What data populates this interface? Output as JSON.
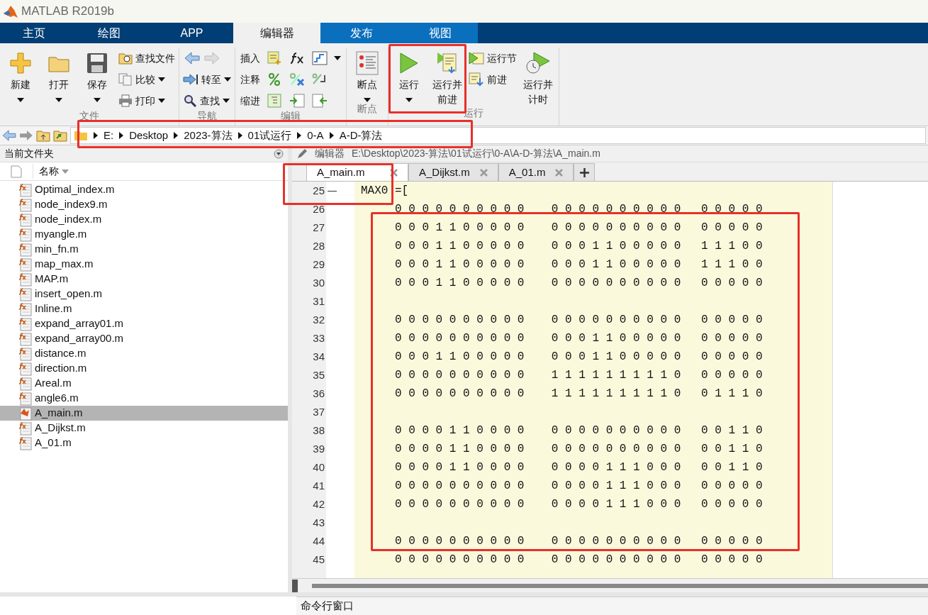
{
  "window": {
    "title": "MATLAB R2019b"
  },
  "tabs": [
    {
      "label": "主页",
      "selected": false,
      "kind": "main"
    },
    {
      "label": "绘图",
      "selected": false,
      "kind": "main"
    },
    {
      "label": "APP",
      "selected": false,
      "kind": "main"
    },
    {
      "label": "编辑器",
      "selected": true
    },
    {
      "label": "发布",
      "selected": false,
      "kind": "contextual"
    },
    {
      "label": "视图",
      "selected": false,
      "kind": "contextual"
    }
  ],
  "ribbon": {
    "groups": [
      {
        "label": "文件",
        "items": [
          {
            "kind": "large",
            "label": "新建",
            "dropdown": true
          },
          {
            "kind": "large",
            "label": "打开",
            "dropdown": true
          },
          {
            "kind": "large",
            "label": "保存",
            "dropdown": true
          },
          {
            "kind": "stack",
            "entries": [
              {
                "label": "查找文件",
                "dropdown": false
              },
              {
                "label": "比较",
                "dropdown": true
              },
              {
                "label": "打印",
                "dropdown": true
              }
            ]
          }
        ]
      },
      {
        "label": "导航",
        "items": [
          {
            "kind": "stack",
            "entries": [
              {
                "kind": "arrows"
              },
              {
                "label": "转至",
                "dropdown": true
              },
              {
                "label": "查找",
                "dropdown": true
              }
            ]
          }
        ]
      },
      {
        "label": "编辑",
        "items": [
          {
            "kind": "rows",
            "entries": [
              {
                "label": "插入",
                "dropdown": true
              },
              {
                "label": "注释",
                "dropdown": false
              },
              {
                "label": "缩进",
                "dropdown": false
              }
            ]
          }
        ]
      },
      {
        "label": "断点",
        "items": [
          {
            "kind": "large",
            "label": "断点",
            "dropdown": true
          }
        ]
      },
      {
        "label": "运行",
        "items": [
          {
            "kind": "large",
            "label": "运行",
            "dropdown": true
          },
          {
            "kind": "large",
            "lines": [
              "运行并",
              "前进"
            ],
            "dropdown": false
          },
          {
            "kind": "stack",
            "entries": [
              {
                "label": "运行节",
                "dropdown": false
              },
              {
                "label": "前进",
                "dropdown": false
              }
            ]
          },
          {
            "kind": "large",
            "lines": [
              "运行并",
              "计时"
            ],
            "dropdown": false
          }
        ]
      }
    ]
  },
  "address_bar": {
    "segments": [
      "E:",
      "Desktop",
      "2023-算法",
      "01试运行",
      "0-A",
      "A-D-算法"
    ]
  },
  "file_browser": {
    "title": "当前文件夹",
    "column": "名称",
    "files": [
      {
        "name": "Optimal_index.m",
        "kind": "function",
        "selected": false
      },
      {
        "name": "node_index9.m",
        "kind": "function",
        "selected": false
      },
      {
        "name": "node_index.m",
        "kind": "function",
        "selected": false
      },
      {
        "name": "myangle.m",
        "kind": "function",
        "selected": false
      },
      {
        "name": "min_fn.m",
        "kind": "function",
        "selected": false
      },
      {
        "name": "map_max.m",
        "kind": "function",
        "selected": false
      },
      {
        "name": "MAP.m",
        "kind": "function",
        "selected": false
      },
      {
        "name": "insert_open.m",
        "kind": "function",
        "selected": false
      },
      {
        "name": "Inline.m",
        "kind": "function",
        "selected": false
      },
      {
        "name": "expand_array01.m",
        "kind": "function",
        "selected": false
      },
      {
        "name": "expand_array00.m",
        "kind": "function",
        "selected": false
      },
      {
        "name": "distance.m",
        "kind": "function",
        "selected": false
      },
      {
        "name": "direction.m",
        "kind": "function",
        "selected": false
      },
      {
        "name": "Areal.m",
        "kind": "function",
        "selected": false
      },
      {
        "name": "angle6.m",
        "kind": "function",
        "selected": false
      },
      {
        "name": "A_main.m",
        "kind": "script",
        "selected": true
      },
      {
        "name": "A_Dijkst.m",
        "kind": "function",
        "selected": false
      },
      {
        "name": "A_01.m",
        "kind": "function",
        "selected": false
      }
    ]
  },
  "editor": {
    "label": "编辑器",
    "path": "E:\\Desktop\\2023-算法\\01试运行\\0-A\\A-D-算法\\A_main.m",
    "tabs": [
      {
        "label": "A_main.m",
        "selected": true
      },
      {
        "label": "A_Dijkst.m",
        "selected": false
      },
      {
        "label": "A_01.m",
        "selected": false
      }
    ],
    "lines": [
      {
        "number": "25",
        "marker": "—",
        "text": "MAX0 =["
      },
      {
        "number": "26",
        "text": "     0 0 0 0 0 0 0 0 0 0    0 0 0 0 0 0 0 0 0 0   0 0 0 0 0"
      },
      {
        "number": "27",
        "text": "     0 0 0 1 1 0 0 0 0 0    0 0 0 0 0 0 0 0 0 0   0 0 0 0 0"
      },
      {
        "number": "28",
        "text": "     0 0 0 1 1 0 0 0 0 0    0 0 0 1 1 0 0 0 0 0   1 1 1 0 0"
      },
      {
        "number": "29",
        "text": "     0 0 0 1 1 0 0 0 0 0    0 0 0 1 1 0 0 0 0 0   1 1 1 0 0"
      },
      {
        "number": "30",
        "text": "     0 0 0 1 1 0 0 0 0 0    0 0 0 0 0 0 0 0 0 0   0 0 0 0 0"
      },
      {
        "number": "31"
      },
      {
        "number": "32",
        "text": "     0 0 0 0 0 0 0 0 0 0    0 0 0 0 0 0 0 0 0 0   0 0 0 0 0"
      },
      {
        "number": "33",
        "text": "     0 0 0 0 0 0 0 0 0 0    0 0 0 1 1 0 0 0 0 0   0 0 0 0 0"
      },
      {
        "number": "34",
        "text": "     0 0 0 1 1 0 0 0 0 0    0 0 0 1 1 0 0 0 0 0   0 0 0 0 0"
      },
      {
        "number": "35",
        "text": "     0 0 0 0 0 0 0 0 0 0    1 1 1 1 1 1 1 1 1 0   0 0 0 0 0"
      },
      {
        "number": "36",
        "text": "     0 0 0 0 0 0 0 0 0 0    1 1 1 1 1 1 1 1 1 0   0 1 1 1 0"
      },
      {
        "number": "37"
      },
      {
        "number": "38",
        "text": "     0 0 0 0 1 1 0 0 0 0    0 0 0 0 0 0 0 0 0 0   0 0 1 1 0"
      },
      {
        "number": "39",
        "text": "     0 0 0 0 1 1 0 0 0 0    0 0 0 0 0 0 0 0 0 0   0 0 1 1 0"
      },
      {
        "number": "40",
        "text": "     0 0 0 0 1 1 0 0 0 0    0 0 0 0 1 1 1 0 0 0   0 0 1 1 0"
      },
      {
        "number": "41",
        "text": "     0 0 0 0 0 0 0 0 0 0    0 0 0 0 1 1 1 0 0 0   0 0 0 0 0"
      },
      {
        "number": "42",
        "text": "     0 0 0 0 0 0 0 0 0 0    0 0 0 0 1 1 1 0 0 0   0 0 0 0 0"
      },
      {
        "number": "43"
      },
      {
        "number": "44",
        "text": "     0 0 0 0 0 0 0 0 0 0    0 0 0 0 0 0 0 0 0 0   0 0 0 0 0"
      },
      {
        "number": "45",
        "text": "     0 0 0 0 0 0 0 0 0 0    0 0 0 0 0 0 0 0 0 0   0 0 0 0 0"
      }
    ]
  },
  "command_window": {
    "title": "命令行窗口"
  }
}
